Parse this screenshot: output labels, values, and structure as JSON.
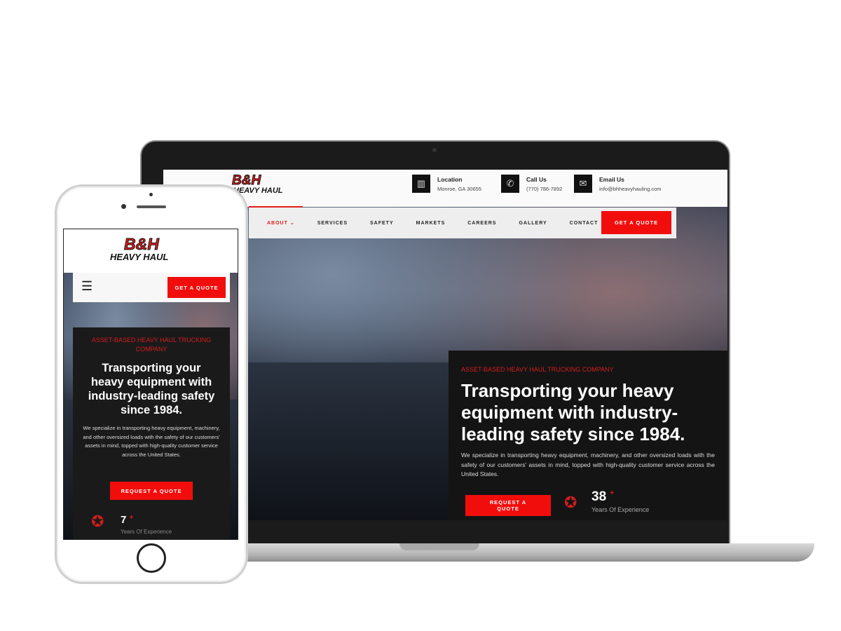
{
  "brand": {
    "logo_top": "B&H",
    "logo_bottom": "HEAVY HAUL"
  },
  "header": {
    "location": {
      "label": "Location",
      "value": "Monroe, GA 30655",
      "icon": "building-icon"
    },
    "call": {
      "label": "Call Us",
      "value": "(770) 786-7892",
      "icon": "phone-icon"
    },
    "email": {
      "label": "Email Us",
      "value": "info@bhheavyhauling.com",
      "icon": "envelope-icon"
    }
  },
  "nav": {
    "items": [
      "ABOUT",
      "SERVICES",
      "SAFETY",
      "MARKETS",
      "CAREERS",
      "GALLERY",
      "CONTACT"
    ],
    "cta": "GET A QUOTE"
  },
  "hero": {
    "tagline": "ASSET-BASED HEAVY HAUL TRUCKING COMPANY",
    "title": "Transporting your heavy equipment with industry-leading safety since 1984.",
    "body": "We specialize in transporting heavy equipment, machinery, and other oversized loads with the safety of our customers' assets in mind, topped with high-quality customer service across the United States.",
    "cta": "REQUEST A QUOTE"
  },
  "stats": {
    "desktop": {
      "value": "38",
      "suffix": "+",
      "label": "Years Of Experience"
    },
    "mobile": {
      "value": "7",
      "suffix": "+",
      "label": "Years Of Experience"
    }
  },
  "colors": {
    "accent": "#f20d0d",
    "dark": "#141414"
  }
}
